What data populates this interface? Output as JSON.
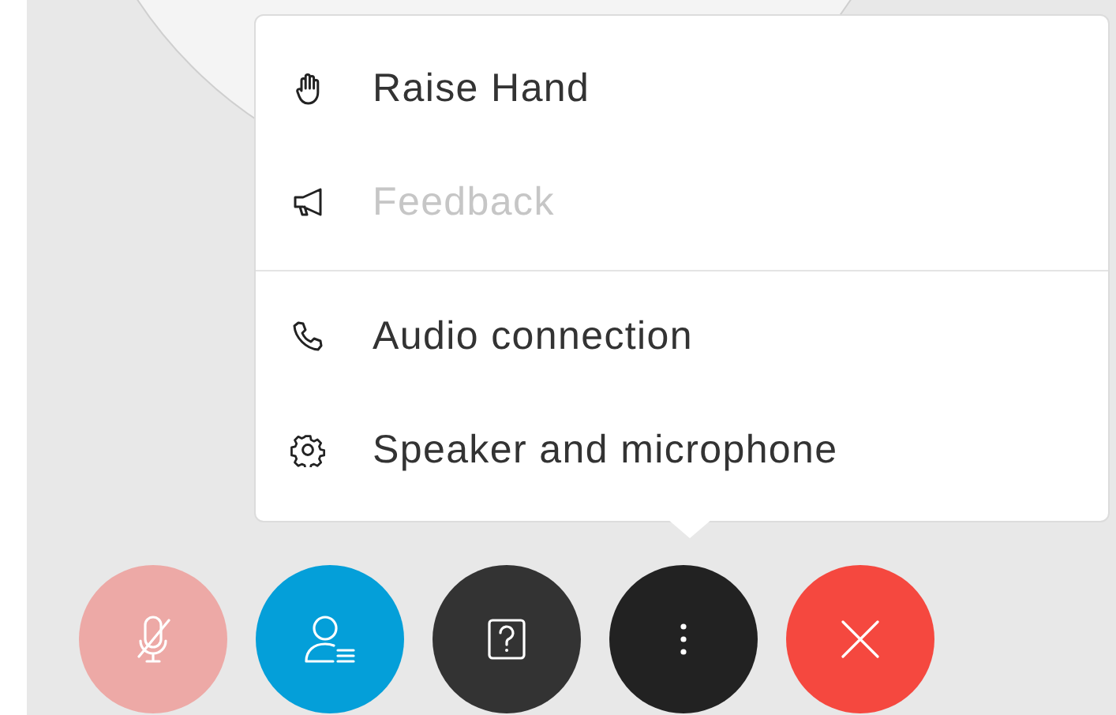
{
  "menu": {
    "groups": [
      [
        {
          "label": "Raise Hand",
          "disabled": false
        },
        {
          "label": "Feedback",
          "disabled": true
        }
      ],
      [
        {
          "label": "Audio connection",
          "disabled": false
        },
        {
          "label": "Speaker and microphone",
          "disabled": false
        }
      ]
    ]
  },
  "toolbar": {
    "buttons": [
      {
        "kind": "mic",
        "disabled": true
      },
      {
        "kind": "participants",
        "disabled": false
      },
      {
        "kind": "help",
        "disabled": false
      },
      {
        "kind": "more",
        "disabled": false
      },
      {
        "kind": "leave",
        "disabled": false
      }
    ]
  }
}
